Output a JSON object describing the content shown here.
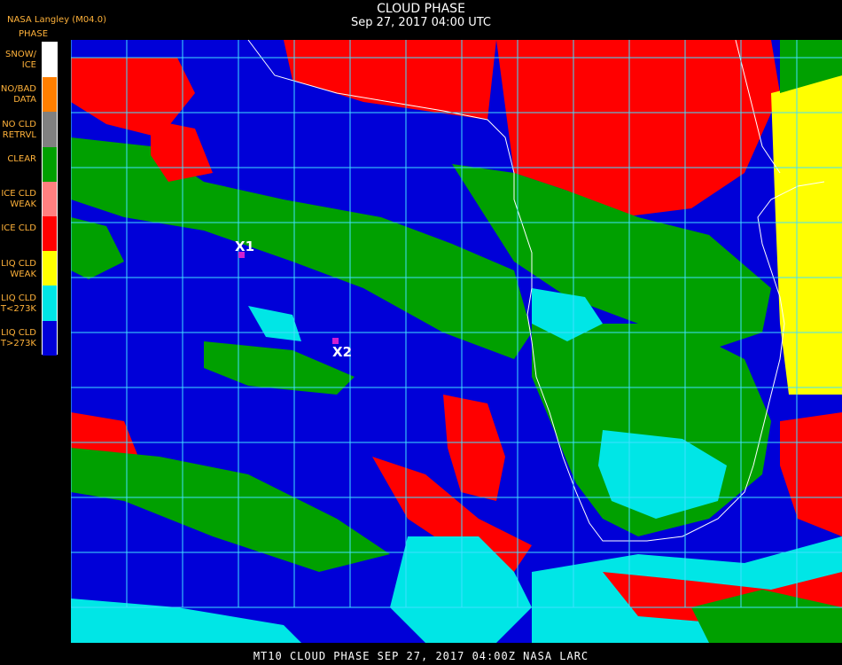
{
  "header": {
    "title": "CLOUD PHASE",
    "subtitle": "Sep 27, 2017 04:00 UTC",
    "credit": "NASA Langley (M04.0)",
    "legend_title": "PHASE"
  },
  "legend": {
    "items": [
      {
        "line1": "SNOW/",
        "line2": "ICE",
        "color": "#ffffff"
      },
      {
        "line1": "NO/BAD",
        "line2": "DATA",
        "color": "#ff7f00"
      },
      {
        "line1": "NO CLD",
        "line2": "RETRVL",
        "color": "#808080"
      },
      {
        "line1": "CLEAR",
        "line2": "",
        "color": "#00a000"
      },
      {
        "line1": "ICE CLD",
        "line2": "WEAK",
        "color": "#ff8080"
      },
      {
        "line1": "ICE CLD",
        "line2": "",
        "color": "#ff0000"
      },
      {
        "line1": "LIQ CLD",
        "line2": "WEAK",
        "color": "#ffff00"
      },
      {
        "line1": "LIQ CLD",
        "line2": "T<273K",
        "color": "#00e6e6"
      },
      {
        "line1": "LIQ CLD",
        "line2": "T>273K",
        "color": "#0000d8"
      }
    ]
  },
  "markers": [
    {
      "label": "X1"
    },
    {
      "label": "X2"
    }
  ],
  "colors": {
    "grid": "#40e0ff",
    "coast": "#ffffff",
    "marker_dot": "#d020d0"
  },
  "footer": {
    "text": "MT10  CLOUD PHASE   SEP 27, 2017 04:00Z   NASA LARC"
  }
}
